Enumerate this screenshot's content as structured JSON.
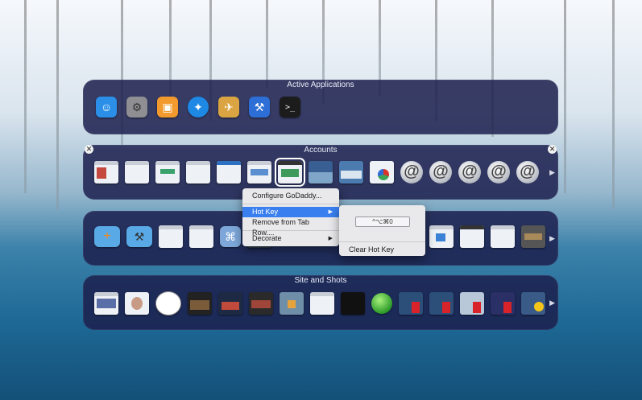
{
  "panels": {
    "active": {
      "title": "Active Applications"
    },
    "accounts": {
      "title": "Accounts"
    },
    "third": {
      "title": ""
    },
    "site": {
      "title": "Site and Shots"
    }
  },
  "active_apps": [
    {
      "name": "finder-icon",
      "glyph": "☺",
      "bg": "#2b8fe8"
    },
    {
      "name": "system-preferences-icon",
      "glyph": "⚙",
      "bg": "#8e8e93"
    },
    {
      "name": "photos-app-icon",
      "glyph": "▣",
      "bg": "#f29a2e"
    },
    {
      "name": "safari-icon",
      "glyph": "✦",
      "bg": "#1e88e5"
    },
    {
      "name": "preview-icon",
      "glyph": "✈",
      "bg": "#d9a441"
    },
    {
      "name": "xcode-icon",
      "glyph": "⚒",
      "bg": "#2d6fd6"
    },
    {
      "name": "terminal-icon",
      "glyph": ">_",
      "bg": "#1c1c1c"
    }
  ],
  "context_menu": {
    "configure": "Configure GoDaddy...",
    "hot_key": "Hot Key",
    "remove": "Remove from Tab Row....",
    "decorate": "Decorate",
    "submenu_arrow": "▶"
  },
  "hotkey_menu": {
    "shortcut": "^⌥⌘0",
    "clear": "Clear Hot Key"
  },
  "more_arrow": "▶",
  "close_glyph": "✕",
  "at_glyph": "@"
}
